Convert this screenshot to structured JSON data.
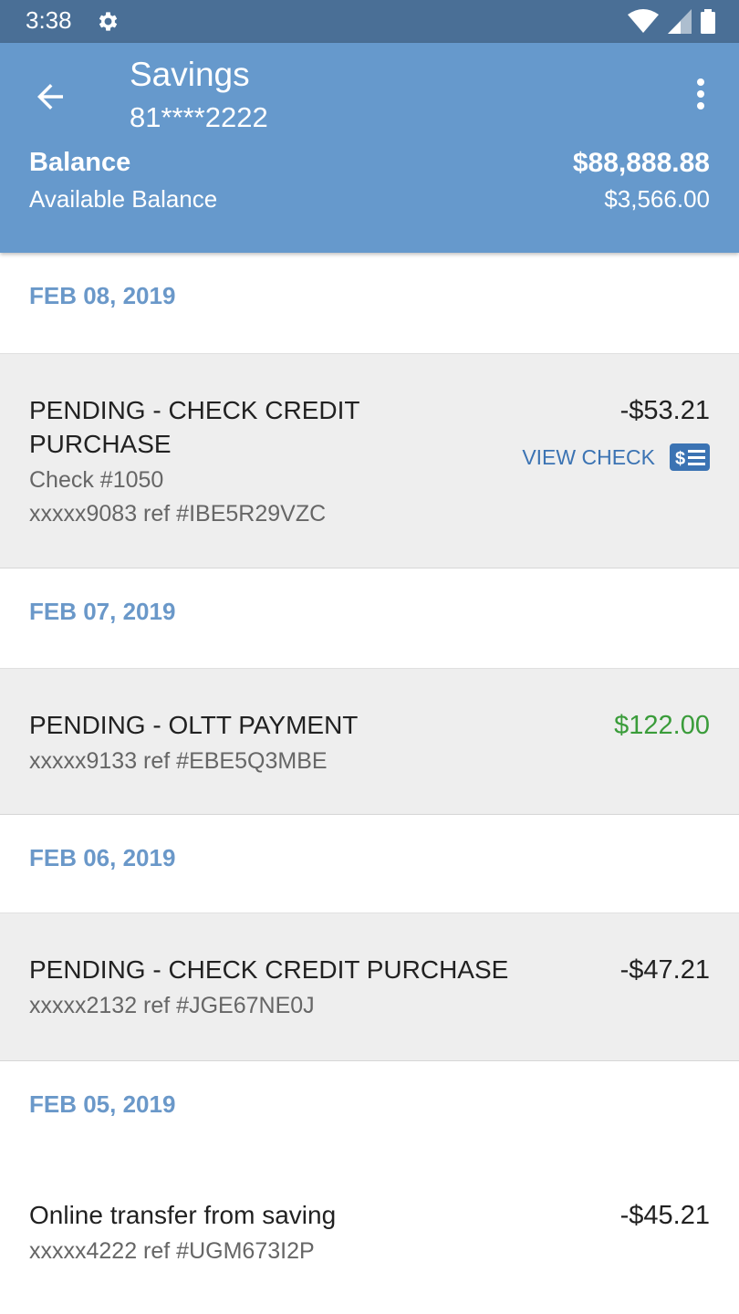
{
  "status": {
    "time": "3:38"
  },
  "header": {
    "title": "Savings",
    "account": "81****2222",
    "balance_label": "Balance",
    "balance_value": "$88,888.88",
    "available_label": "Available Balance",
    "available_value": "$3,566.00"
  },
  "groups": [
    {
      "date": "FEB 08, 2019",
      "tx": {
        "desc_line1": "PENDING - CHECK CREDIT",
        "desc_line2": "PURCHASE",
        "check": "Check #1050",
        "ref": "xxxxx9083 ref #IBE5R29VZC",
        "amount": "-$53.21",
        "action": "VIEW CHECK"
      }
    },
    {
      "date": "FEB 07, 2019",
      "tx": {
        "desc": "PENDING - OLTT PAYMENT",
        "ref": "xxxxx9133 ref #EBE5Q3MBE",
        "amount": "$122.00"
      }
    },
    {
      "date": "FEB 06, 2019",
      "tx": {
        "desc": "PENDING - CHECK CREDIT PURCHASE",
        "ref": "xxxxx2132 ref #JGE67NE0J",
        "amount": "-$47.21"
      }
    },
    {
      "date": "FEB 05, 2019",
      "tx": {
        "desc": "Online transfer from saving",
        "ref": "xxxxx4222 ref #UGM673I2P",
        "amount": "-$45.21"
      }
    }
  ],
  "colors": {
    "header": "#6699cc",
    "accent": "#6a98c9",
    "credit": "#3a9c3a",
    "link": "#3b73b3"
  },
  "icons": [
    "settings-icon",
    "wifi-icon",
    "signal-icon",
    "battery-icon",
    "back-arrow-icon",
    "more-vert-icon",
    "check-icon"
  ]
}
